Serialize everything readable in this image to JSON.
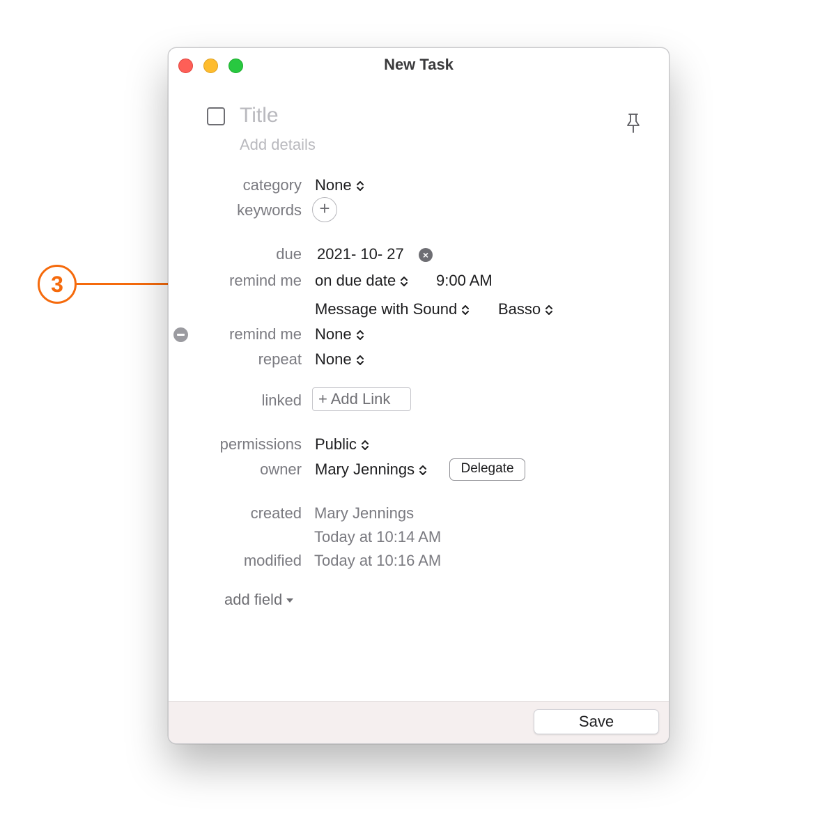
{
  "window": {
    "title": "New Task"
  },
  "task": {
    "title_placeholder": "Title",
    "details_placeholder": "Add details"
  },
  "fields": {
    "category": {
      "label": "category",
      "value": "None"
    },
    "keywords": {
      "label": "keywords",
      "add_symbol": "+"
    },
    "due": {
      "label": "due",
      "value": "2021- 10- 27",
      "clear_symbol": "×"
    },
    "remind1": {
      "label": "remind me",
      "when": "on due date",
      "time": "9:00 AM",
      "alert_type": "Message with Sound",
      "sound": "Basso"
    },
    "remind2": {
      "label": "remind me",
      "value": "None"
    },
    "repeat": {
      "label": "repeat",
      "value": "None"
    },
    "linked": {
      "label": "linked",
      "button": "+ Add Link"
    },
    "permissions": {
      "label": "permissions",
      "value": "Public"
    },
    "owner": {
      "label": "owner",
      "value": "Mary Jennings",
      "button": "Delegate"
    },
    "created": {
      "label": "created",
      "by": "Mary Jennings",
      "at": "Today at 10:14 AM"
    },
    "modified": {
      "label": "modified",
      "at": "Today at 10:16 AM"
    }
  },
  "add_field": {
    "label": "add field"
  },
  "footer": {
    "save_label": "Save"
  },
  "callout": {
    "number": "3",
    "color": "#f56a0c"
  },
  "icons": [
    "close-window-icon",
    "minimize-window-icon",
    "zoom-window-icon",
    "pin-icon",
    "chevron-updown-icon",
    "plus-circle-icon",
    "clear-x-icon",
    "remove-minus-icon",
    "caret-down-icon"
  ]
}
